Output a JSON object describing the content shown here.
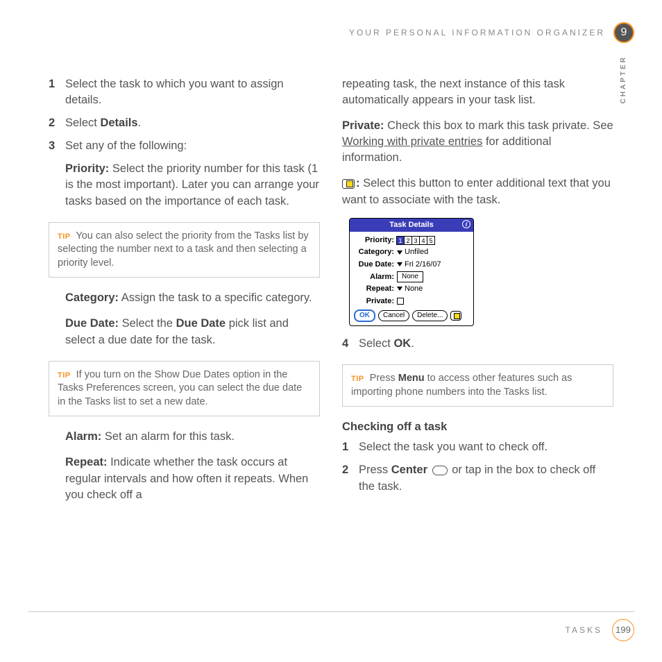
{
  "header": {
    "running_title": "YOUR PERSONAL INFORMATION ORGANIZER",
    "chapter_number": "9",
    "chapter_label": "CHAPTER"
  },
  "left": {
    "step1": {
      "num": "1",
      "text": "Select the task to which you want to assign details."
    },
    "step2": {
      "num": "2",
      "prefix": "Select ",
      "bold": "Details",
      "suffix": "."
    },
    "step3": {
      "num": "3",
      "text": "Set any of the following:"
    },
    "priority": {
      "label": "Priority:",
      "text": " Select the priority number for this task (1 is the most important). Later you can arrange your tasks based on the importance of each task."
    },
    "tip1": {
      "label": "TIP",
      "text": " You can also select the priority from the Tasks list by selecting the number next to a task and then selecting a priority level."
    },
    "category": {
      "label": "Category:",
      "text": " Assign the task to a specific category."
    },
    "duedate": {
      "label": "Due Date:",
      "text1": " Select the ",
      "bold": "Due Date",
      "text2": " pick list and select a due date for the task."
    },
    "tip2": {
      "label": "TIP",
      "text": " If you turn on the Show Due Dates option in the Tasks Preferences screen, you can select the due date in the Tasks list to set a new date."
    },
    "alarm": {
      "label": "Alarm:",
      "text": " Set an alarm for this task."
    },
    "repeat": {
      "label": "Repeat:",
      "text": " Indicate whether the task occurs at regular intervals and how often it repeats. When you check off a"
    }
  },
  "right": {
    "repeat_cont": "repeating task, the next instance of this task automatically appears in your task list.",
    "private": {
      "label": "Private:",
      "text1": " Check this box to mark this task private. See ",
      "link": "Working with private entries",
      "text2": " for additional information."
    },
    "note": {
      "colon": ":",
      "text": " Select this button to enter additional text that you want to associate with the task."
    },
    "dialog": {
      "title": "Task Details",
      "priority_label": "Priority:",
      "priorities": [
        "1",
        "2",
        "3",
        "4",
        "5"
      ],
      "category_label": "Category:",
      "category_value": "Unfiled",
      "duedate_label": "Due Date:",
      "duedate_value": "Fri 2/16/07",
      "alarm_label": "Alarm:",
      "alarm_value": "None",
      "repeat_label": "Repeat:",
      "repeat_value": "None",
      "private_label": "Private:",
      "ok": "OK",
      "cancel": "Cancel",
      "delete": "Delete..."
    },
    "step4": {
      "num": "4",
      "prefix": "Select ",
      "bold": "OK",
      "suffix": "."
    },
    "tip3": {
      "label": "TIP",
      "text1": " Press ",
      "bold": "Menu",
      "text2": " to access other features such as importing phone numbers into the Tasks list."
    },
    "section": "Checking off a task",
    "c1": {
      "num": "1",
      "text": "Select the task you want to check off."
    },
    "c2": {
      "num": "2",
      "prefix": "Press ",
      "bold": "Center",
      "suffix": " or tap in the box to check off the task."
    }
  },
  "footer": {
    "section": "TASKS",
    "page": "199"
  }
}
